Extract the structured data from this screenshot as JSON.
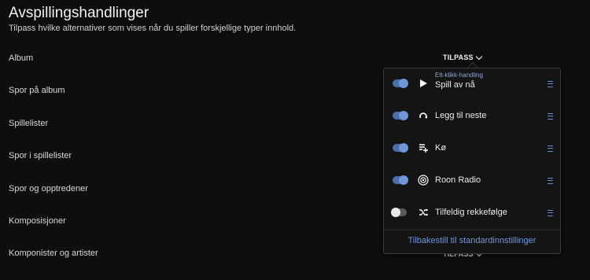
{
  "header": {
    "title": "Avspillingshandlinger",
    "subtitle": "Tilpass hvilke alternativer som vises når du spiller forskjellige typer innhold."
  },
  "rows": [
    {
      "label": "Album"
    },
    {
      "label": "Spor på album"
    },
    {
      "label": "Spillelister"
    },
    {
      "label": "Spor i spillelister"
    },
    {
      "label": "Spor og opptredener"
    },
    {
      "label": "Komposisjoner"
    },
    {
      "label": "Komponister og artister"
    }
  ],
  "customize_label": "TILPASS",
  "popup": {
    "items": [
      {
        "sublabel": "Ett-klikk-handling",
        "label": "Spill av nå",
        "icon": "play-icon",
        "enabled": true
      },
      {
        "label": "Legg til neste",
        "icon": "play-next-icon",
        "enabled": true
      },
      {
        "label": "Kø",
        "icon": "queue-add-icon",
        "enabled": true
      },
      {
        "label": "Roon Radio",
        "icon": "radio-icon",
        "enabled": true
      },
      {
        "label": "Tilfeldig rekkefølge",
        "icon": "shuffle-icon",
        "enabled": false
      }
    ],
    "reset_label": "Tilbakestill til standardinnstillinger"
  },
  "colors": {
    "background": "#0e0e0e",
    "accent": "#6f97dc",
    "toggle_on": "#4c6ea6"
  }
}
